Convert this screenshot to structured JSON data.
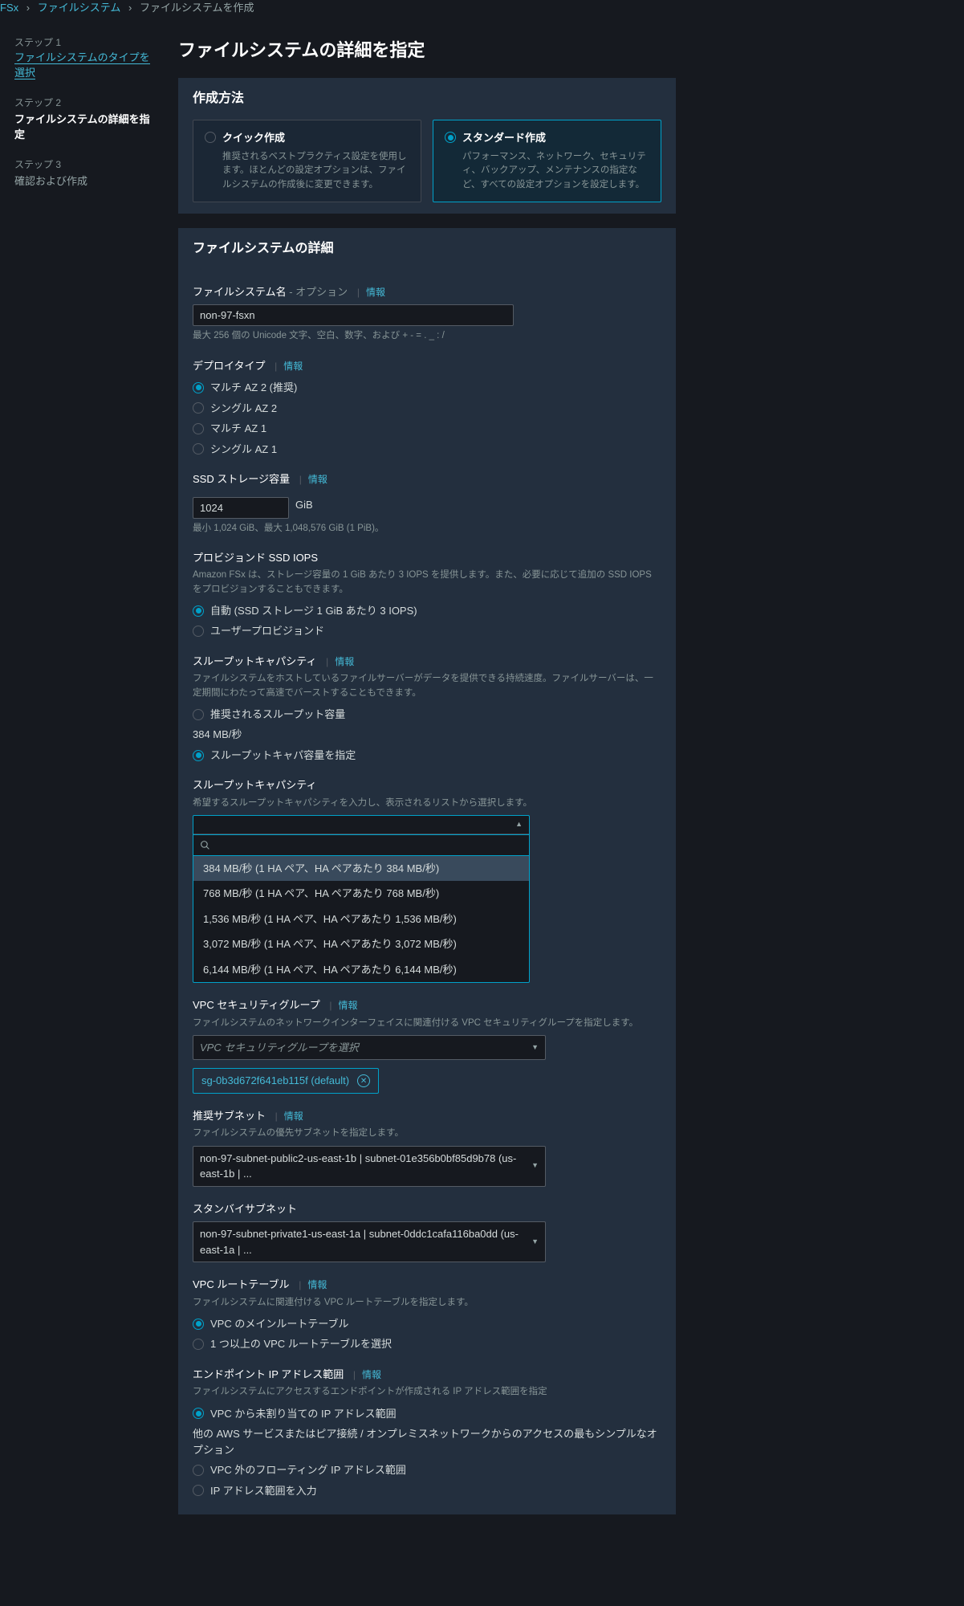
{
  "breadcrumb": {
    "root": "FSx",
    "mid": "ファイルシステム",
    "cur": "ファイルシステムを作成"
  },
  "steps": {
    "s1_num": "ステップ 1",
    "s1_lbl": "ファイルシステムのタイプを選択",
    "s2_num": "ステップ 2",
    "s2_lbl": "ファイルシステムの詳細を指定",
    "s3_num": "ステップ 3",
    "s3_lbl": "確認および作成"
  },
  "title": "ファイルシステムの詳細を指定",
  "info": "情報",
  "method": {
    "heading": "作成方法",
    "quick_title": "クイック作成",
    "quick_desc": "推奨されるベストプラクティス設定を使用します。ほとんどの設定オプションは、ファイルシステムの作成後に変更できます。",
    "std_title": "スタンダード作成",
    "std_desc": "パフォーマンス、ネットワーク、セキュリティ、バックアップ、メンテナンスの指定など、すべての設定オプションを設定します。"
  },
  "details": {
    "heading": "ファイルシステムの詳細",
    "name_label": "ファイルシステム名 ",
    "name_opt": "- オプション",
    "name_value": "non-97-fsxn",
    "name_hint": "最大 256 個の Unicode 文字、空白、数字、および + - = . _ : /",
    "deploy_label": "デプロイタイプ",
    "deploy_opts": {
      "a": "マルチ AZ 2 (推奨)",
      "b": "シングル AZ 2",
      "c": "マルチ AZ 1",
      "d": "シングル AZ 1"
    },
    "ssd_label": "SSD ストレージ容量",
    "ssd_value": "1024",
    "ssd_unit": "GiB",
    "ssd_hint": "最小 1,024 GiB、最大 1,048,576 GiB (1 PiB)。",
    "iops_label": "プロビジョンド SSD IOPS",
    "iops_hint": "Amazon FSx は、ストレージ容量の 1 GiB あたり 3 IOPS を提供します。また、必要に応じて追加の SSD IOPS をプロビジョンすることもできます。",
    "iops_auto": "自動 (SSD ストレージ 1 GiB あたり 3 IOPS)",
    "iops_user": "ユーザープロビジョンド",
    "tcap_label": "スループットキャパシティ",
    "tcap_hint": "ファイルシステムをホストしているファイルサーバーがデータを提供できる持続速度。ファイルサーバーは、一定期間にわたって高速でバーストすることもできます。",
    "tcap_rec": "推奨されるスループット容量",
    "tcap_rec_sub": "384 MB/秒",
    "tcap_spec": "スループットキャパ容量を指定",
    "tsel_label": "スループットキャパシティ",
    "tsel_hint": "希望するスループットキャパシティを入力し、表示されるリストから選択します。",
    "tsel_search_ph": "",
    "tsel_opts": {
      "a": "384 MB/秒 (1 HA ペア、HA ペアあたり 384 MB/秒)",
      "b": "768 MB/秒 (1 HA ペア、HA ペアあたり 768 MB/秒)",
      "c": "1,536 MB/秒 (1 HA ペア、HA ペアあたり 1,536 MB/秒)",
      "d": "3,072 MB/秒 (1 HA ペア、HA ペアあたり 3,072 MB/秒)",
      "e": "6,144 MB/秒 (1 HA ペア、HA ペアあたり 6,144 MB/秒)"
    },
    "sg_label": "VPC セキュリティグループ",
    "sg_hint": "ファイルシステムのネットワークインターフェイスに関連付ける VPC セキュリティグループを指定します。",
    "sg_placeholder": "VPC セキュリティグループを選択",
    "sg_tag": "sg-0b3d672f641eb115f (default)",
    "psubnet_label": "推奨サブネット",
    "psubnet_hint": "ファイルシステムの優先サブネットを指定します。",
    "psubnet_value": "non-97-subnet-public2-us-east-1b | subnet-01e356b0bf85d9b78 (us-east-1b | ...",
    "ssubnet_label": "スタンバイサブネット",
    "ssubnet_value": "non-97-subnet-private1-us-east-1a | subnet-0ddc1cafa116ba0dd (us-east-1a | ...",
    "rt_label": "VPC ルートテーブル",
    "rt_hint": "ファイルシステムに関連付ける VPC ルートテーブルを指定します。",
    "rt_a": "VPC のメインルートテーブル",
    "rt_b": "1 つ以上の VPC ルートテーブルを選択",
    "ep_label": "エンドポイント IP アドレス範囲",
    "ep_hint": "ファイルシステムにアクセスするエンドポイントが作成される IP アドレス範囲を指定",
    "ep_a": "VPC から未割り当ての IP アドレス範囲",
    "ep_a_sub": "他の AWS サービスまたはピア接続 / オンプレミスネットワークからのアクセスの最もシンプルなオプション",
    "ep_b": "VPC 外のフローティング IP アドレス範囲",
    "ep_c": "IP アドレス範囲を入力"
  }
}
